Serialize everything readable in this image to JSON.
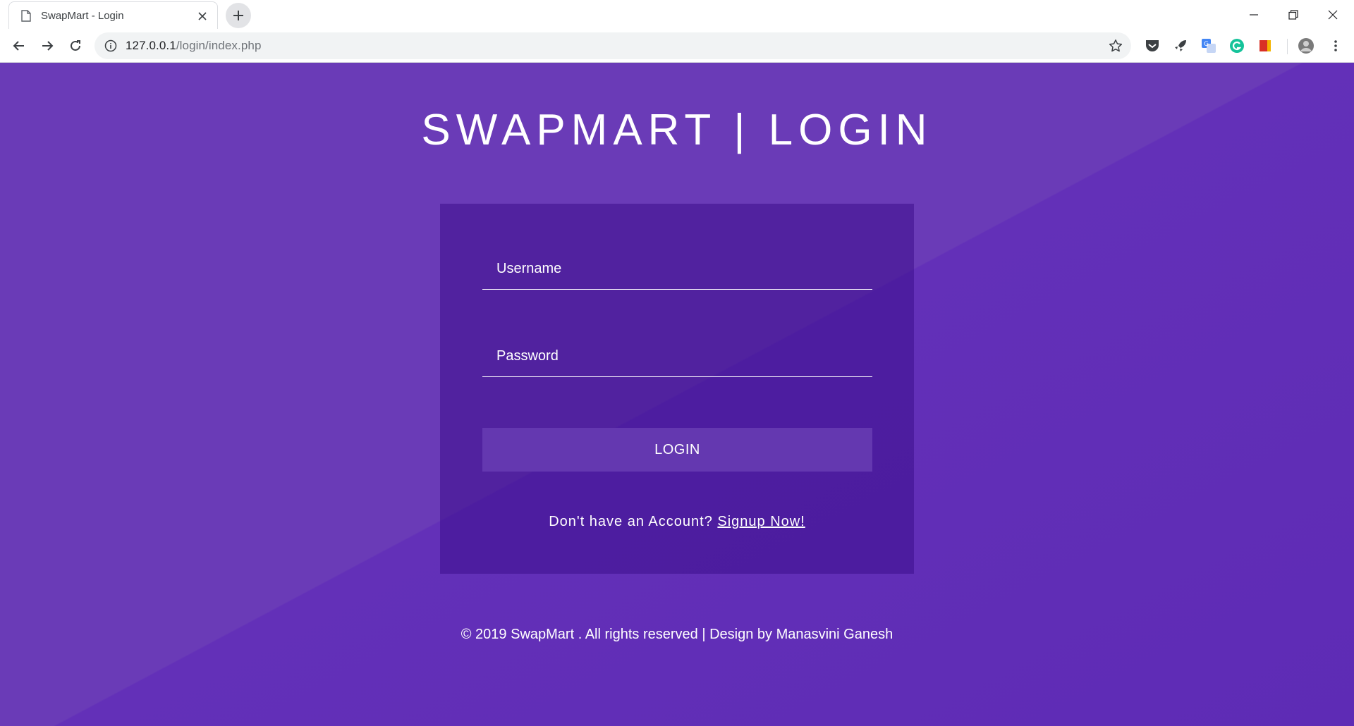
{
  "browser": {
    "tab_title": "SwapMart - Login",
    "url_host": "127.0.0.1",
    "url_path": "/login/index.php"
  },
  "page": {
    "title": "SWAPMART | LOGIN",
    "username_placeholder": "Username",
    "password_placeholder": "Password",
    "login_label": "LOGIN",
    "signup_prompt": "Don't have an Account?",
    "signup_link": "Signup Now!",
    "footer": "© 2019 SwapMart . All rights reserved | Design by Manasvini Ganesh"
  },
  "colors": {
    "background": "#6a3bb7",
    "card": "#4a1f99",
    "button": "#6438b0"
  }
}
